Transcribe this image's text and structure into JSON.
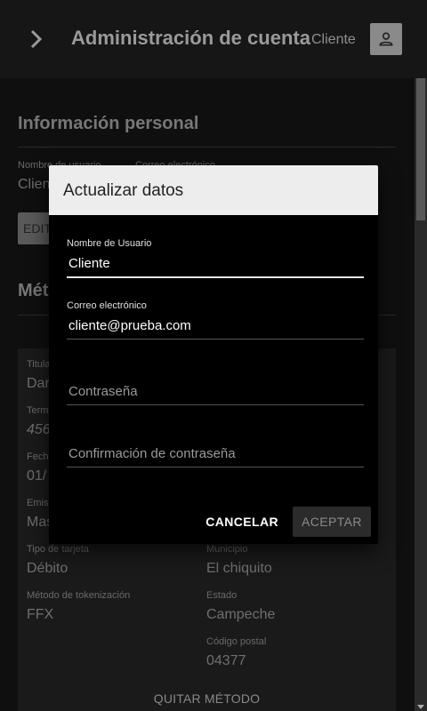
{
  "appbar": {
    "title": "Administración de cuenta",
    "user_label": "Cliente",
    "menu_icon": "chevron-right-icon",
    "avatar_icon": "person-icon"
  },
  "page": {
    "personal_section_title": "Información personal",
    "username_label": "Nombre de usuario",
    "username_value": "Clien",
    "email_label": "Correo electrónico",
    "edit_button": "EDIT",
    "methods_section_title": "Mét",
    "card": {
      "holder_label": "Titula",
      "holder_value": "Dar",
      "terminal_label": "Term",
      "terminal_value": "456",
      "date_label": "Fecha",
      "date_value": "01/",
      "issuer_label": "Emis",
      "issuer_value": "Mas",
      "card_type_label": "Tipo de tarjeta",
      "card_type_value": "Débito",
      "tokenization_label": "Método de tokenización",
      "tokenization_value": "FFX",
      "municipality_label": "Municipio",
      "municipality_value": "El chiquito",
      "state_label": "Estado",
      "state_value": "Campeche",
      "zip_label": "Código postal",
      "zip_value": "04377",
      "remove_button": "QUITAR MÉTODO"
    }
  },
  "dialog": {
    "title": "Actualizar datos",
    "username_label": "Nombre de Usuario",
    "username_value": "Cliente",
    "email_label": "Correo electrónico",
    "email_value": "cliente@prueba.com",
    "password_placeholder": "Contraseña",
    "password_confirm_placeholder": "Confirmación de contraseña",
    "cancel_button": "CANCELAR",
    "accept_button": "ACEPTAR"
  },
  "colors": {
    "appbar_bg": "#161616",
    "dialog_header_bg": "#ededed",
    "dialog_bg": "#000000"
  }
}
